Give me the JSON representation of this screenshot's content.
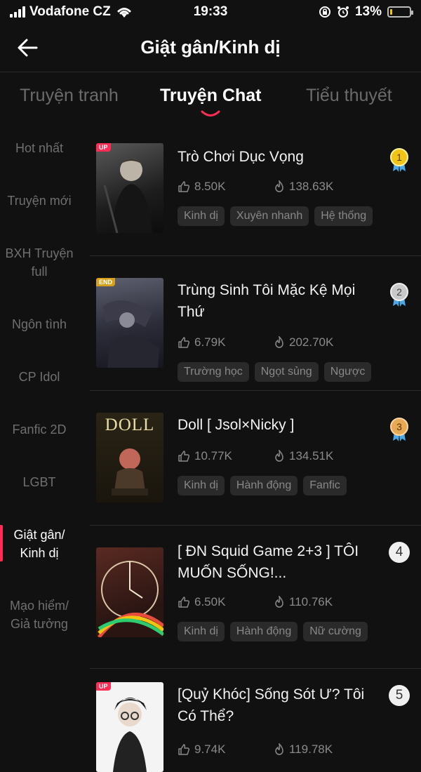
{
  "status_bar": {
    "carrier": "Vodafone CZ",
    "time": "19:33",
    "battery": "13%",
    "battery_level": 0.13,
    "signal_bars": 4
  },
  "header": {
    "title": "Giật gân/Kinh dị",
    "back_icon": "arrow-left-icon"
  },
  "tabs": [
    {
      "label": "Truyện tranh",
      "active": false
    },
    {
      "label": "Truyện Chat",
      "active": true
    },
    {
      "label": "Tiểu thuyết",
      "active": false
    }
  ],
  "sidebar": {
    "items": [
      {
        "label": "Hot nhất"
      },
      {
        "label": "Truyện mới"
      },
      {
        "label": "BXH Truyện full"
      },
      {
        "label": "Ngôn tình"
      },
      {
        "label": "CP Idol"
      },
      {
        "label": "Fanfic 2D"
      },
      {
        "label": "LGBT"
      },
      {
        "label": "Giật gân/ Kinh dị",
        "active": true
      },
      {
        "label": "Mạo hiểm/ Giả tưởng"
      }
    ]
  },
  "colors": {
    "accent": "#ff2d55",
    "background": "#111111",
    "tag_bg": "#2a2a2a"
  },
  "stories": [
    {
      "rank": "1",
      "badge": "UP",
      "title": "Trò Chơi Dục Vọng",
      "likes": "8.50K",
      "views": "138.63K",
      "tags": [
        "Kinh dị",
        "Xuyên nhanh",
        "Hệ thống"
      ]
    },
    {
      "rank": "2",
      "badge": "END",
      "title": "Trùng Sinh Tôi Mặc Kệ Mọi Thứ",
      "likes": "6.79K",
      "views": "202.70K",
      "tags": [
        "Trường học",
        "Ngọt sủng",
        "Ngược"
      ]
    },
    {
      "rank": "3",
      "badge": "",
      "cover_text": "DOLL",
      "title": "Doll [ Jsol×Nicky ]",
      "likes": "10.77K",
      "views": "134.51K",
      "tags": [
        "Kinh dị",
        "Hành động",
        "Fanfic"
      ]
    },
    {
      "rank": "4",
      "badge": "",
      "title": "[ ĐN Squid Game 2+3 ] TÔI MUỐN SỐNG!...",
      "likes": "6.50K",
      "views": "110.76K",
      "tags": [
        "Kinh dị",
        "Hành động",
        "Nữ cường"
      ]
    },
    {
      "rank": "5",
      "badge": "UP",
      "title": "[Quỷ Khóc] Sống Sót Ư? Tôi Có Thể?",
      "likes": "9.74K",
      "views": "119.78K",
      "tags": []
    }
  ]
}
